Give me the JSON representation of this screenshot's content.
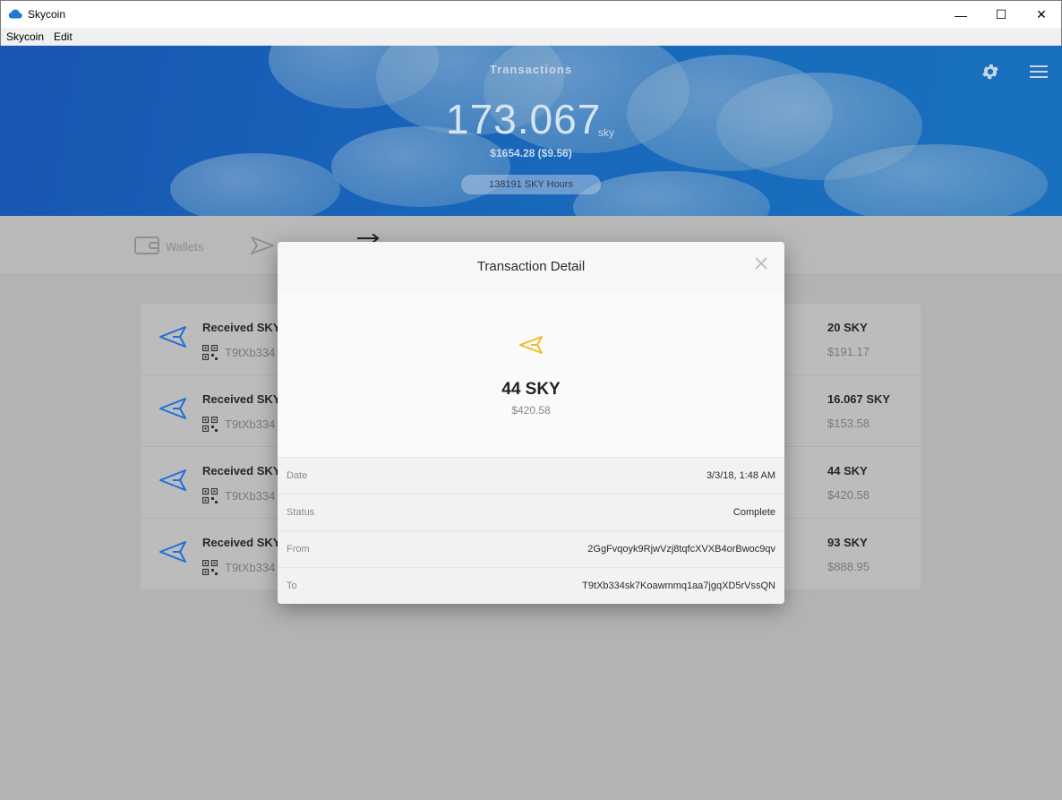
{
  "window": {
    "title": "Skycoin",
    "minimize_glyph": "—",
    "maximize_glyph": "☐",
    "close_glyph": "✕"
  },
  "menubar": {
    "items": [
      "Skycoin",
      "Edit"
    ]
  },
  "header": {
    "title": "Transactions",
    "balance": "173.067",
    "balance_unit": "sky",
    "fiat": "$1654.28 ($9.56)",
    "hours": "138191 SKY Hours"
  },
  "nav": {
    "wallets_label": "Wallets"
  },
  "transactions": [
    {
      "label": "Received SKY",
      "address": "T9tXb334",
      "amount": "20 SKY",
      "fiat": "$191.17"
    },
    {
      "label": "Received SKY",
      "address": "T9tXb334",
      "amount": "16.067 SKY",
      "fiat": "$153.58"
    },
    {
      "label": "Received SKY",
      "address": "T9tXb334",
      "amount": "44 SKY",
      "fiat": "$420.58"
    },
    {
      "label": "Received SKY",
      "address": "T9tXb334",
      "amount": "93 SKY",
      "fiat": "$888.95"
    }
  ],
  "modal": {
    "title": "Transaction Detail",
    "amount": "44 SKY",
    "fiat": "$420.58",
    "rows": [
      {
        "label": "Date",
        "value": "3/3/18, 1:48 AM"
      },
      {
        "label": "Status",
        "value": "Complete"
      },
      {
        "label": "From",
        "value": "2GgFvqoyk9RjwVzj8tqfcXVXB4orBwoc9qv"
      },
      {
        "label": "To",
        "value": "T9tXb334sk7Koawmmq1aa7jgqXD5rVssQN"
      }
    ]
  },
  "colors": {
    "accent_blue": "#1e6fd9",
    "received_icon_blue": "#1e6fd9",
    "modal_icon_gold": "#f2b92c"
  },
  "icons": [
    "skycoin-cloud-icon",
    "gear-icon",
    "hamburger-menu-icon",
    "wallet-icon",
    "send-icon",
    "transactions-arrow-icon",
    "received-arrow-icon",
    "qr-code-icon",
    "close-icon"
  ]
}
